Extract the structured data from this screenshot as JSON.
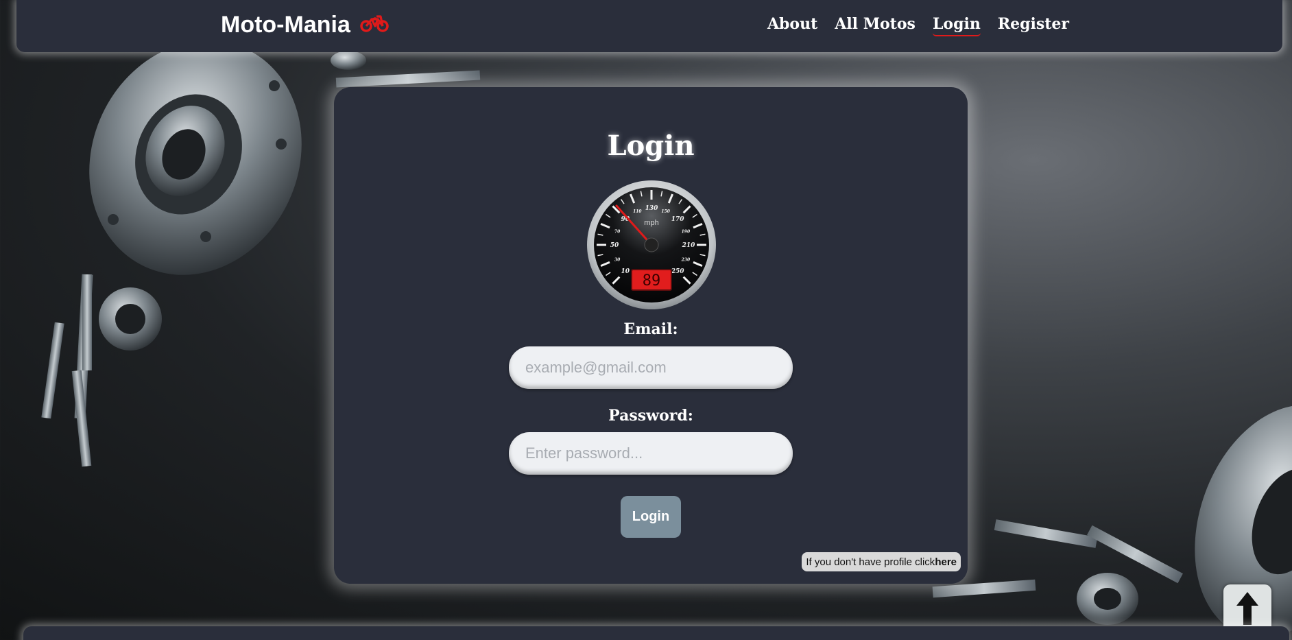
{
  "header": {
    "brand": "Moto-Mania",
    "brand_icon": "motorcycle-icon",
    "nav": [
      {
        "label": "About"
      },
      {
        "label": "All Motos"
      },
      {
        "label": "Login"
      },
      {
        "label": "Register"
      }
    ],
    "active_nav": "Login"
  },
  "card": {
    "title": "Login",
    "gauge": {
      "unit": "mph",
      "ticks": [
        "10",
        "30",
        "50",
        "70",
        "90",
        "110",
        "130",
        "150",
        "170",
        "190",
        "210",
        "230",
        "250"
      ],
      "readout": "89"
    },
    "email_label": "Email:",
    "email_placeholder": "example@gmail.com",
    "email_value": "",
    "password_label": "Password:",
    "password_placeholder": "Enter password...",
    "password_value": "",
    "submit_label": "Login",
    "hint_text": "If you don't have profile click",
    "hint_link": "here"
  },
  "scroll_top_icon": "arrow-up-icon",
  "colors": {
    "panel": "#2a2e3b",
    "accent_red": "#e01a1a",
    "button": "#7b8f9c",
    "input_bg": "#eef0f3"
  }
}
